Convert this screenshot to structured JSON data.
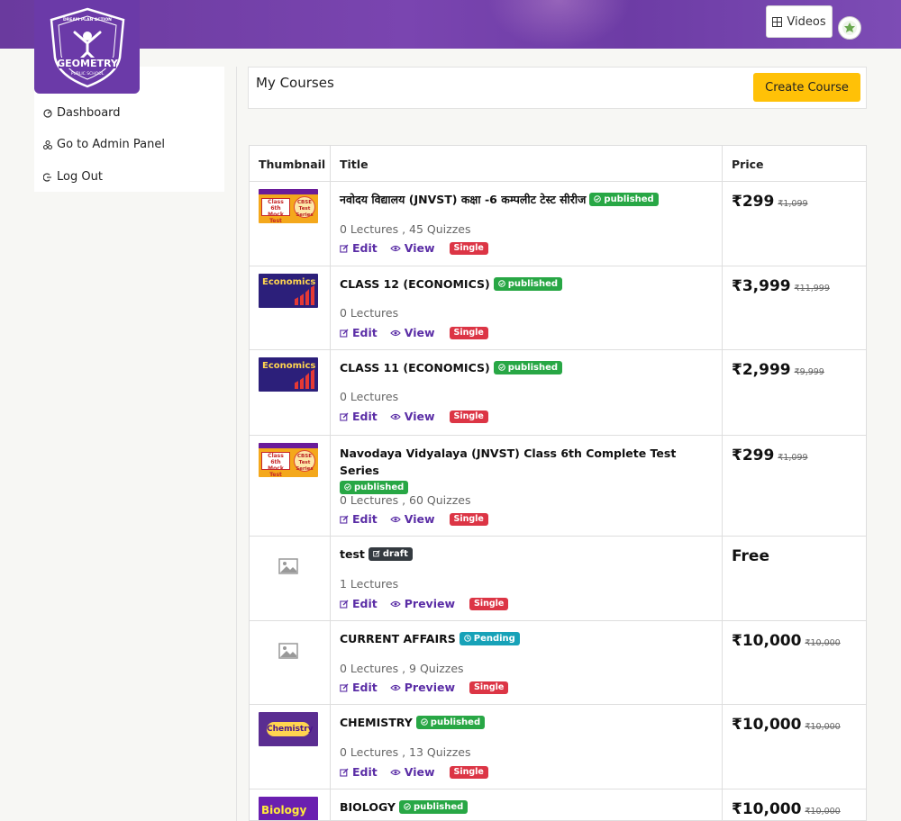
{
  "header": {
    "videos_label": "Videos",
    "create_course_label": "Create Course",
    "page_title": "My Courses"
  },
  "logo": {
    "text_top": "DREAM PLAN ACTION",
    "text_main": "GEOMETRY",
    "text_bottom": "PUBLIC SCHOOL"
  },
  "sidebar": {
    "items": [
      {
        "label": "Dashboard",
        "icon": "gauge-icon"
      },
      {
        "label": "Go to Admin Panel",
        "icon": "admin-icon"
      },
      {
        "label": "Log Out",
        "icon": "logout-icon"
      }
    ]
  },
  "table": {
    "headers": [
      "Thumbnail",
      "Title",
      "Price"
    ],
    "rows": [
      {
        "thumb": "class6",
        "thumb_text": [
          "Class 6th",
          "Mock Test",
          "CBSE Test Series"
        ],
        "title": "नवोदय विद्यालय (JNVST) कक्षा -6 कम्पलीट टेस्ट सीरीज",
        "status": "published",
        "meta": "0 Lectures , 45 Quizzes",
        "edit": "Edit",
        "view": "View",
        "type": "Single",
        "price": "₹299",
        "old_price": "₹1,099"
      },
      {
        "thumb": "econ",
        "thumb_text": [
          "Economics"
        ],
        "title": "CLASS 12 (ECONOMICS)",
        "status": "published",
        "meta": "0 Lectures",
        "edit": "Edit",
        "view": "View",
        "type": "Single",
        "price": "₹3,999",
        "old_price": "₹11,999"
      },
      {
        "thumb": "econ",
        "thumb_text": [
          "Economics"
        ],
        "title": "CLASS 11 (ECONOMICS)",
        "status": "published",
        "meta": "0 Lectures",
        "edit": "Edit",
        "view": "View",
        "type": "Single",
        "price": "₹2,999",
        "old_price": "₹9,999"
      },
      {
        "thumb": "class6",
        "thumb_text": [
          "Class 6th",
          "Mock Test",
          "CBSE Test Series"
        ],
        "title": "Navodaya Vidyalaya (JNVST) Class 6th Complete Test Series",
        "status": "published",
        "meta": "0 Lectures , 60 Quizzes",
        "edit": "Edit",
        "view": "View",
        "type": "Single",
        "price": "₹299",
        "old_price": "₹1,099"
      },
      {
        "thumb": "none",
        "title": "test",
        "status": "draft",
        "meta": "1 Lectures",
        "edit": "Edit",
        "view": "Preview",
        "type": "Single",
        "price": "Free",
        "old_price": ""
      },
      {
        "thumb": "none",
        "title": "CURRENT AFFAIRS",
        "status": "Pending",
        "meta": "0 Lectures , 9 Quizzes",
        "edit": "Edit",
        "view": "Preview",
        "type": "Single",
        "price": "₹10,000",
        "old_price": "₹10,000"
      },
      {
        "thumb": "chem",
        "thumb_text": [
          "Chemistry"
        ],
        "title": "CHEMISTRY",
        "status": "published",
        "meta": "0 Lectures , 13 Quizzes",
        "edit": "Edit",
        "view": "View",
        "type": "Single",
        "price": "₹10,000",
        "old_price": "₹10,000"
      },
      {
        "thumb": "bio",
        "thumb_text": [
          "Biology"
        ],
        "title": "BIOLOGY",
        "status": "published",
        "meta": "",
        "edit": "",
        "view": "",
        "type": "",
        "price": "₹10,000",
        "old_price": "₹10,000"
      }
    ]
  },
  "colors": {
    "brand_purple": "#6b3aa8",
    "accent_yellow": "#ffc107",
    "published_green": "#28a745",
    "draft_dark": "#343a40",
    "pending_teal": "#17a2b8",
    "single_red": "#dc3545",
    "link_purple": "#5b2ea6"
  }
}
